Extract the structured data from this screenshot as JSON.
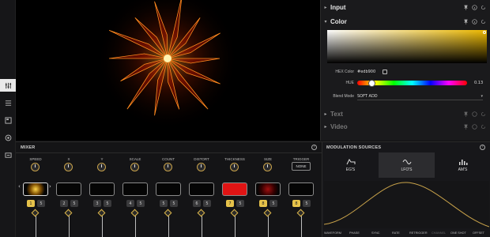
{
  "panel": {
    "input_title": "Input",
    "color_title": "Color",
    "hex_label": "HEX Color",
    "hex_value": "#edb900",
    "hue_label": "HUE",
    "hue_value": "0.13",
    "blend_label": "Blend Mode",
    "blend_value": "SOFT ADD",
    "text_title": "Text",
    "video_title": "Video"
  },
  "mixer": {
    "title": "MIXER",
    "trigger_label": "TRIGGER",
    "trigger_value": "NONE",
    "channels": [
      {
        "label": "SPEED",
        "a": "1",
        "b": "5",
        "active": true
      },
      {
        "label": "X",
        "a": "2",
        "b": "5",
        "active": false
      },
      {
        "label": "Y",
        "a": "3",
        "b": "5",
        "active": false
      },
      {
        "label": "SCALE",
        "a": "4",
        "b": "5",
        "active": false
      },
      {
        "label": "COUNT",
        "a": "5",
        "b": "5",
        "active": false
      },
      {
        "label": "DISTORT",
        "a": "6",
        "b": "5",
        "active": false
      },
      {
        "label": "THICKNESS",
        "a": "7",
        "b": "5",
        "active": true
      },
      {
        "label": "SIZE",
        "a": "8",
        "b": "5",
        "active": true
      },
      {
        "label": "",
        "a": "8",
        "b": "5",
        "active": true
      }
    ]
  },
  "modulation": {
    "title": "MODULATION SOURCES",
    "tabs": [
      {
        "label": "EG'S"
      },
      {
        "label": "LFO'S"
      },
      {
        "label": "AM'S"
      }
    ],
    "footer": [
      "WAVEFORM",
      "PHASE",
      "SYNC",
      "RATE",
      "RETRIGGER",
      "CHANNEL",
      "ONE SHOT",
      "OFFSET"
    ]
  },
  "colors": {
    "accent": "#e6c24a",
    "hex": "#edb900",
    "red": "#e01414"
  }
}
